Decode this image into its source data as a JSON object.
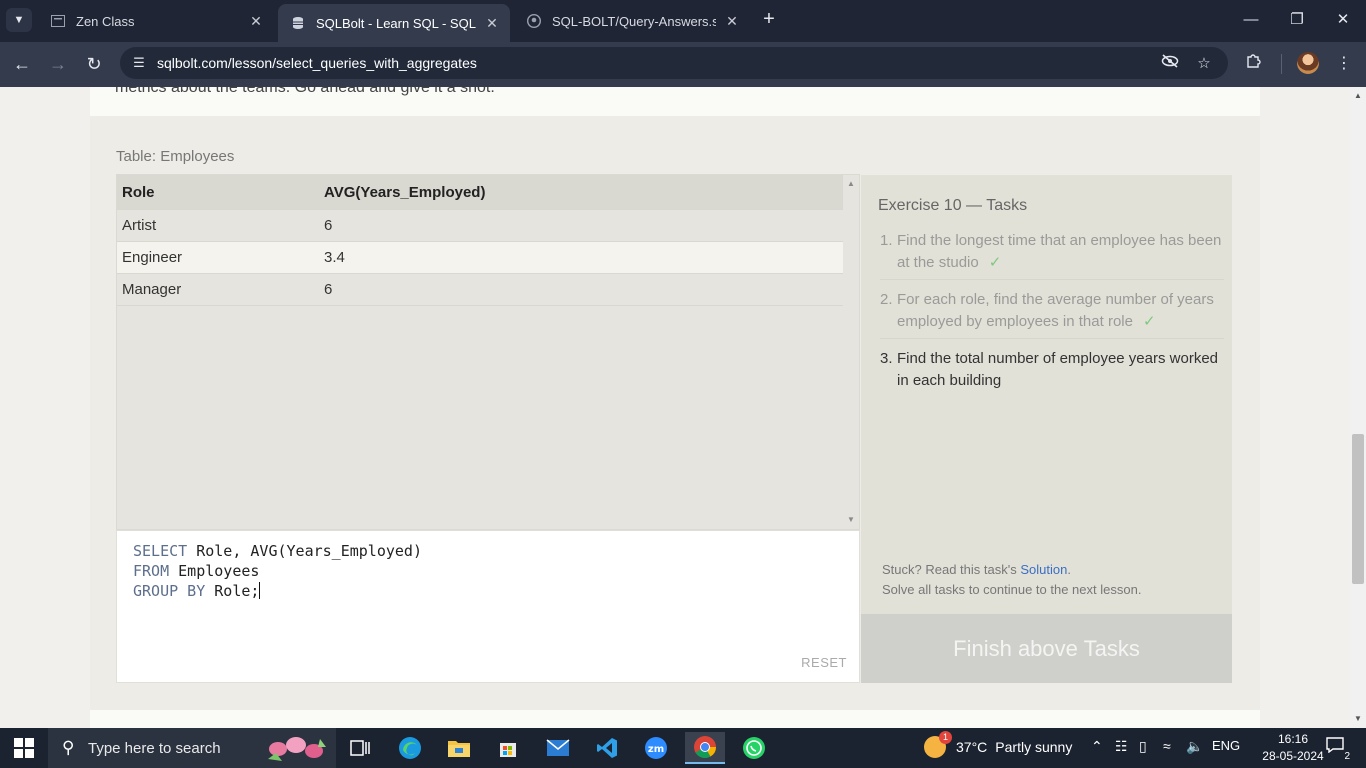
{
  "browser": {
    "tabs": [
      {
        "title": "Zen Class",
        "active": false
      },
      {
        "title": "SQLBolt - Learn SQL - SQL Lesson",
        "active": true
      },
      {
        "title": "SQL-BOLT/Query-Answers.sql at",
        "active": false
      }
    ],
    "url": "sqlbolt.com/lesson/select_queries_with_aggregates"
  },
  "page": {
    "intro_tail": "metrics about the teams. Go ahead and give it a shot.",
    "table_caption": "Table: Employees",
    "results": {
      "columns": [
        "Role",
        "AVG(Years_Employed)"
      ],
      "rows": [
        [
          "Artist",
          "6"
        ],
        [
          "Engineer",
          "3.4"
        ],
        [
          "Manager",
          "6"
        ]
      ]
    },
    "editor": {
      "line1_kw": "SELECT",
      "line1_rest": " Role, AVG(Years_Employed)",
      "line2_kw": "FROM",
      "line2_rest": " Employees",
      "line3_kw": "GROUP BY",
      "line3_rest": " Role;",
      "reset_label": "RESET"
    },
    "tasks": {
      "title": "Exercise 10 — Tasks",
      "items": [
        {
          "num": "1.",
          "text": "Find the longest time that an employee has been at the studio",
          "done": true,
          "check": "✓"
        },
        {
          "num": "2.",
          "text": "For each role, find the average number of years employed by employees in that role",
          "done": true,
          "check": "✓"
        },
        {
          "num": "3.",
          "text": "Find the total number of employee years worked in each building",
          "done": false,
          "check": ""
        }
      ],
      "stuck_prefix": "Stuck? Read this task's ",
      "solution_link": "Solution",
      "stuck_suffix": ".",
      "continue_text": "Solve all tasks to continue to the next lesson.",
      "finish_button": "Finish above Tasks"
    }
  },
  "taskbar": {
    "search_placeholder": "Type here to search",
    "weather_temp": "37°C",
    "weather_desc": "Partly sunny",
    "weather_badge": "1",
    "language": "ENG",
    "time": "16:16",
    "date": "28-05-2024",
    "notification_count": "2"
  }
}
